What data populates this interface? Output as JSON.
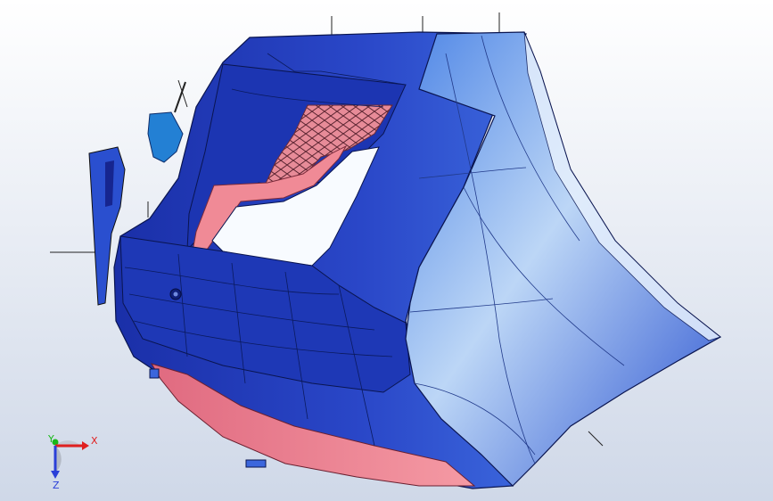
{
  "viewport": {
    "background": {
      "top": "#ffffff",
      "bottom": "#cfd8e8"
    }
  },
  "model": {
    "colors": {
      "body_dark": "#1a2fa8",
      "body_mid": "#2f55d6",
      "body_light": "#c7ddf7",
      "trim": "#f07a88",
      "trim_dark": "#c94b63",
      "bracket": "#1f7fd1",
      "edge": "#1a1a3a"
    }
  },
  "triad": {
    "x_label": "X",
    "y_label": "Y",
    "z_label": "Z",
    "colors": {
      "x": "#e02020",
      "y": "#18b818",
      "z": "#2a3fd8"
    }
  }
}
